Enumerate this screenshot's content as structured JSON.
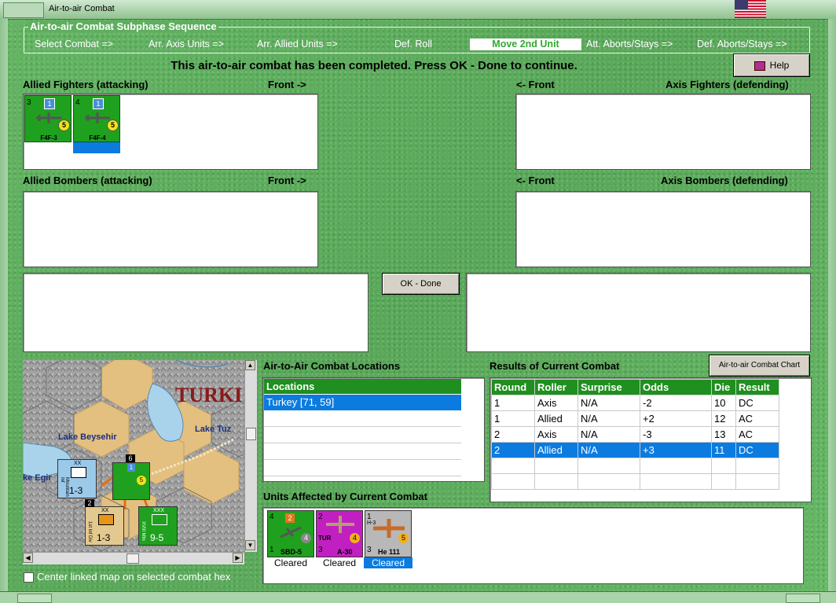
{
  "window": {
    "title": "Air-to-air Combat"
  },
  "subphase": {
    "legend": "Air-to-air Combat Subphase Sequence",
    "steps": [
      "Select Combat =>",
      "Arr. Axis Units =>",
      "Arr. Allied Units =>",
      "Def. Roll",
      "Move 2nd Unit",
      "Att. Aborts/Stays =>",
      "Def. Aborts/Stays =>"
    ],
    "active_index": 4
  },
  "status_message": "This air-to-air combat has been completed.  Press OK - Done to continue.",
  "help_label": "Help",
  "allied_fighters": {
    "label": "Allied Fighters (attacking)",
    "front": "Front ->",
    "units": [
      {
        "name": "F4F-3",
        "top_left": "3",
        "badge": "1",
        "circle": "5"
      },
      {
        "name": "F4F-4",
        "top_left": "4",
        "badge": "1",
        "circle": "5"
      }
    ]
  },
  "axis_fighters": {
    "label": "Axis Fighters (defending)",
    "front": "<- Front"
  },
  "allied_bombers": {
    "label": "Allied Bombers (attacking)",
    "front": "Front ->"
  },
  "axis_bombers": {
    "label": "Axis Bombers (defending)",
    "front": "<- Front"
  },
  "ok_done_label": "OK - Done",
  "map": {
    "labels": {
      "turkey": "TURKI",
      "lake_beysehir": "Lake Beysehir",
      "lake_tuz": "Lake Tuz",
      "lake_egir": "ke Egir"
    },
    "units": [
      {
        "name": "Mountain Inf",
        "size": "XX",
        "value": "1-3"
      },
      {
        "name": "1st Inf Div",
        "size": "XX",
        "value": "1-3",
        "stack": "2"
      },
      {
        "name": "XVIII Mtn",
        "size": "XXX",
        "value": "9-5"
      },
      {
        "name": "air",
        "badge": "1",
        "circle": "5",
        "stack": "6"
      }
    ],
    "center_checkbox_label": "Center linked map on selected combat hex"
  },
  "locations": {
    "label": "Air-to-Air Combat Locations",
    "header": "Locations",
    "rows": [
      "Turkey [71, 59]"
    ]
  },
  "results": {
    "label": "Results of Current Combat",
    "chart_button": "Air-to-air Combat Chart",
    "columns": [
      "Round",
      "Roller",
      "Surprise",
      "Odds",
      "Die",
      "Result"
    ],
    "rows": [
      [
        "1",
        "Axis",
        "N/A",
        "-2",
        "10",
        "DC"
      ],
      [
        "1",
        "Allied",
        "N/A",
        "+2",
        "12",
        "AC"
      ],
      [
        "2",
        "Axis",
        "N/A",
        "-3",
        "13",
        "AC"
      ],
      [
        "2",
        "Allied",
        "N/A",
        "+3",
        "11",
        "DC"
      ]
    ],
    "selected_row": 3
  },
  "units_affected": {
    "label": "Units Affected by Current Combat",
    "units": [
      {
        "name": "SBD-5",
        "top_left": "4",
        "top": "2",
        "circle": "4",
        "bottom_left": "1",
        "status": "Cleared",
        "color": "#1fa11f"
      },
      {
        "name": "A-30",
        "top_left": "2",
        "tag": "TUR",
        "circle": "4",
        "bottom_left": "3",
        "status": "Cleared",
        "color": "#c21fc2"
      },
      {
        "name": "He 111",
        "top_left": "1",
        "tag": "H-3",
        "circle": "5",
        "bottom_left": "3",
        "status": "Cleared",
        "color": "#b8b8b8"
      }
    ]
  },
  "colors": {
    "accent": "#1f8f1f",
    "selection": "#0b7be0",
    "background": "#5fae5f"
  }
}
